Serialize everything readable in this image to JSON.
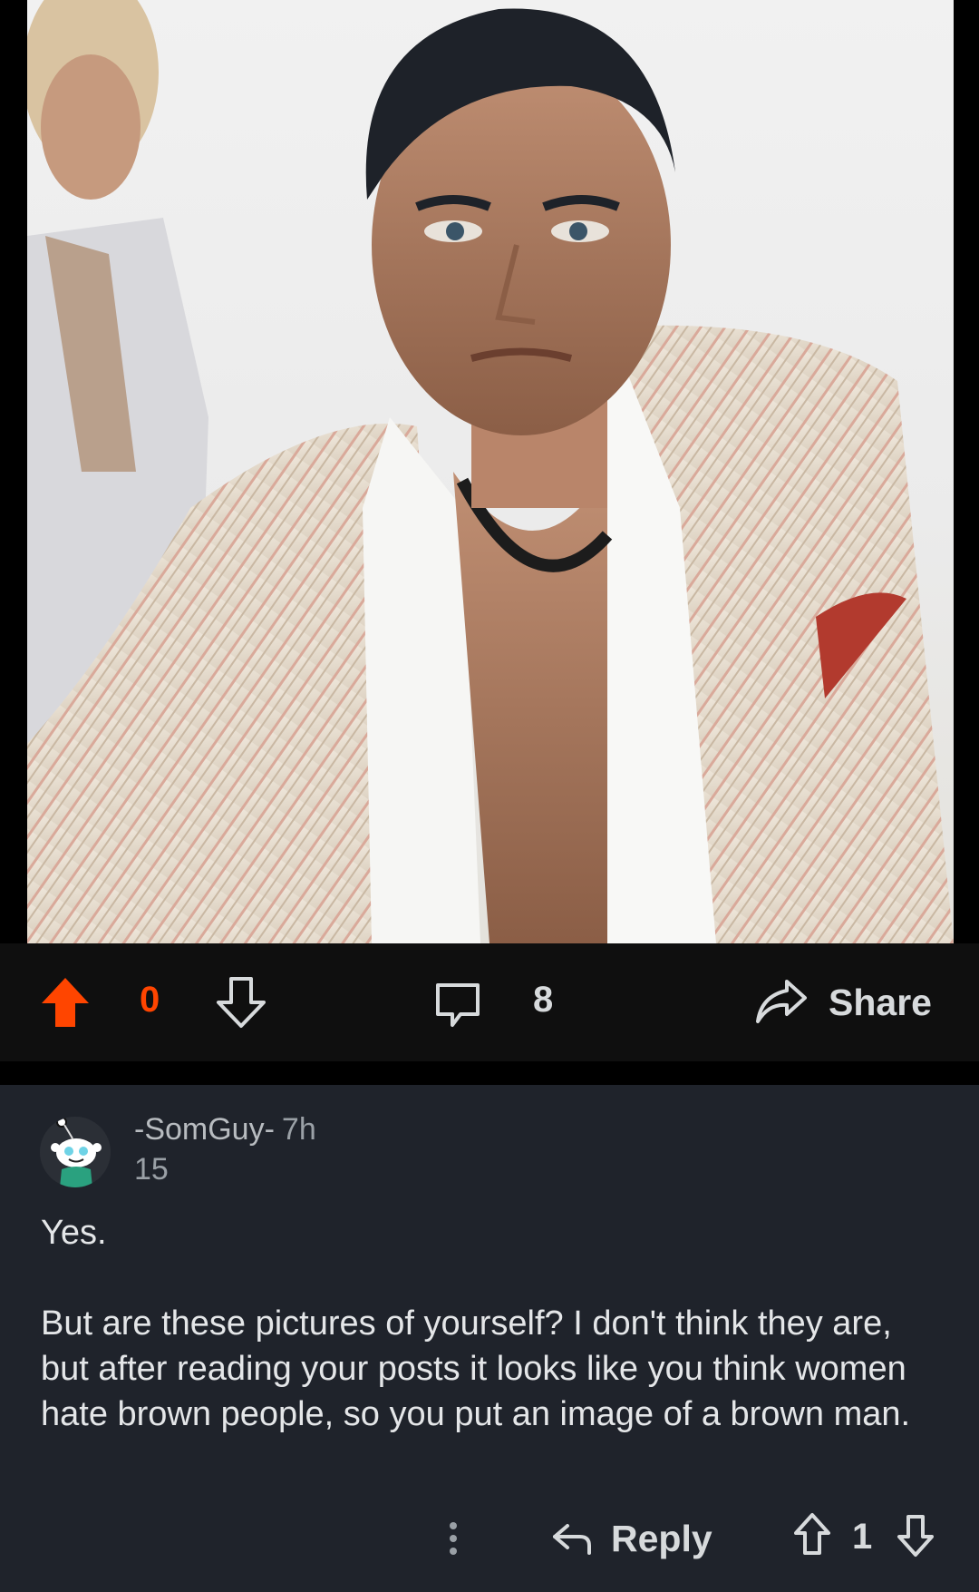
{
  "post": {
    "image_alt": "Photo of a man in a striped white jacket",
    "vote_count": "0",
    "comment_count": "8",
    "share_label": "Share",
    "colors": {
      "upvote_active": "#ff4500",
      "bar_bg": "#0f0f0f",
      "text": "#d7dadc"
    }
  },
  "comment": {
    "author": "-SomGuy-",
    "time": "7h",
    "author_karma": "15",
    "body": [
      "Yes.",
      "But are these pictures of yourself? I don't think they are, but after reading your posts it looks like you think women hate brown people, so you put an image of a brown man."
    ],
    "reply_label": "Reply",
    "score": "1",
    "icons": [
      "more-icon",
      "reply-icon",
      "upvote-icon",
      "downvote-icon"
    ],
    "colors": {
      "bg": "#1f232b"
    }
  }
}
